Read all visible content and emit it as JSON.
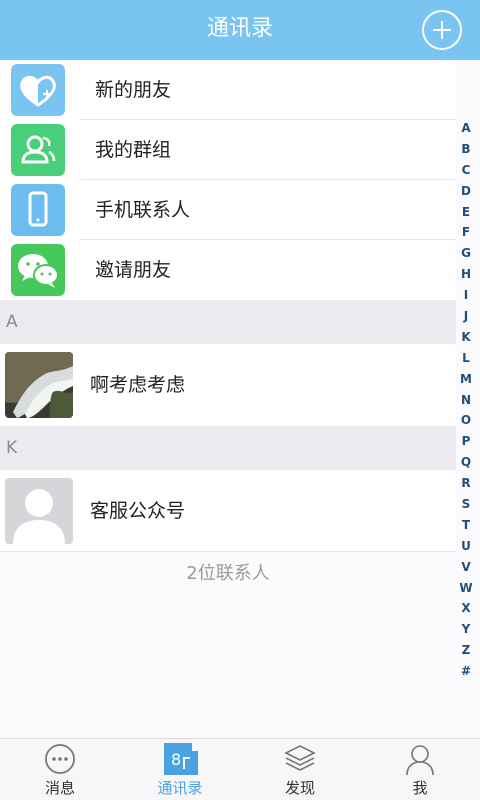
{
  "header": {
    "title": "通讯录"
  },
  "menu": [
    {
      "label": "新的朋友",
      "icon": "heart-plus-icon",
      "color": "#7ac4f2"
    },
    {
      "label": "我的群组",
      "icon": "group-icon",
      "color": "#49cf7a"
    },
    {
      "label": "手机联系人",
      "icon": "phone-icon",
      "color": "#6cbcf0"
    },
    {
      "label": "邀请朋友",
      "icon": "wechat-icon",
      "color": "#46c85a"
    }
  ],
  "sections": [
    {
      "letter": "A",
      "contacts": [
        {
          "name": "啊考虑考虑"
        }
      ]
    },
    {
      "letter": "K",
      "contacts": [
        {
          "name": "客服公众号"
        }
      ]
    }
  ],
  "count_text": "2位联系人",
  "alphabet": [
    "A",
    "B",
    "C",
    "D",
    "E",
    "F",
    "G",
    "H",
    "I",
    "J",
    "K",
    "L",
    "M",
    "N",
    "O",
    "P",
    "Q",
    "R",
    "S",
    "T",
    "U",
    "V",
    "W",
    "X",
    "Y",
    "Z",
    "#"
  ],
  "tabs": [
    {
      "label": "消息",
      "icon": "chat-bubble-icon",
      "active": false
    },
    {
      "label": "通讯录",
      "icon": "contacts-icon",
      "active": true
    },
    {
      "label": "发现",
      "icon": "layers-icon",
      "active": false
    },
    {
      "label": "我",
      "icon": "person-icon",
      "active": false
    }
  ],
  "colors": {
    "header": "#7ac4f2",
    "active_tab": "#4aa3e0"
  }
}
